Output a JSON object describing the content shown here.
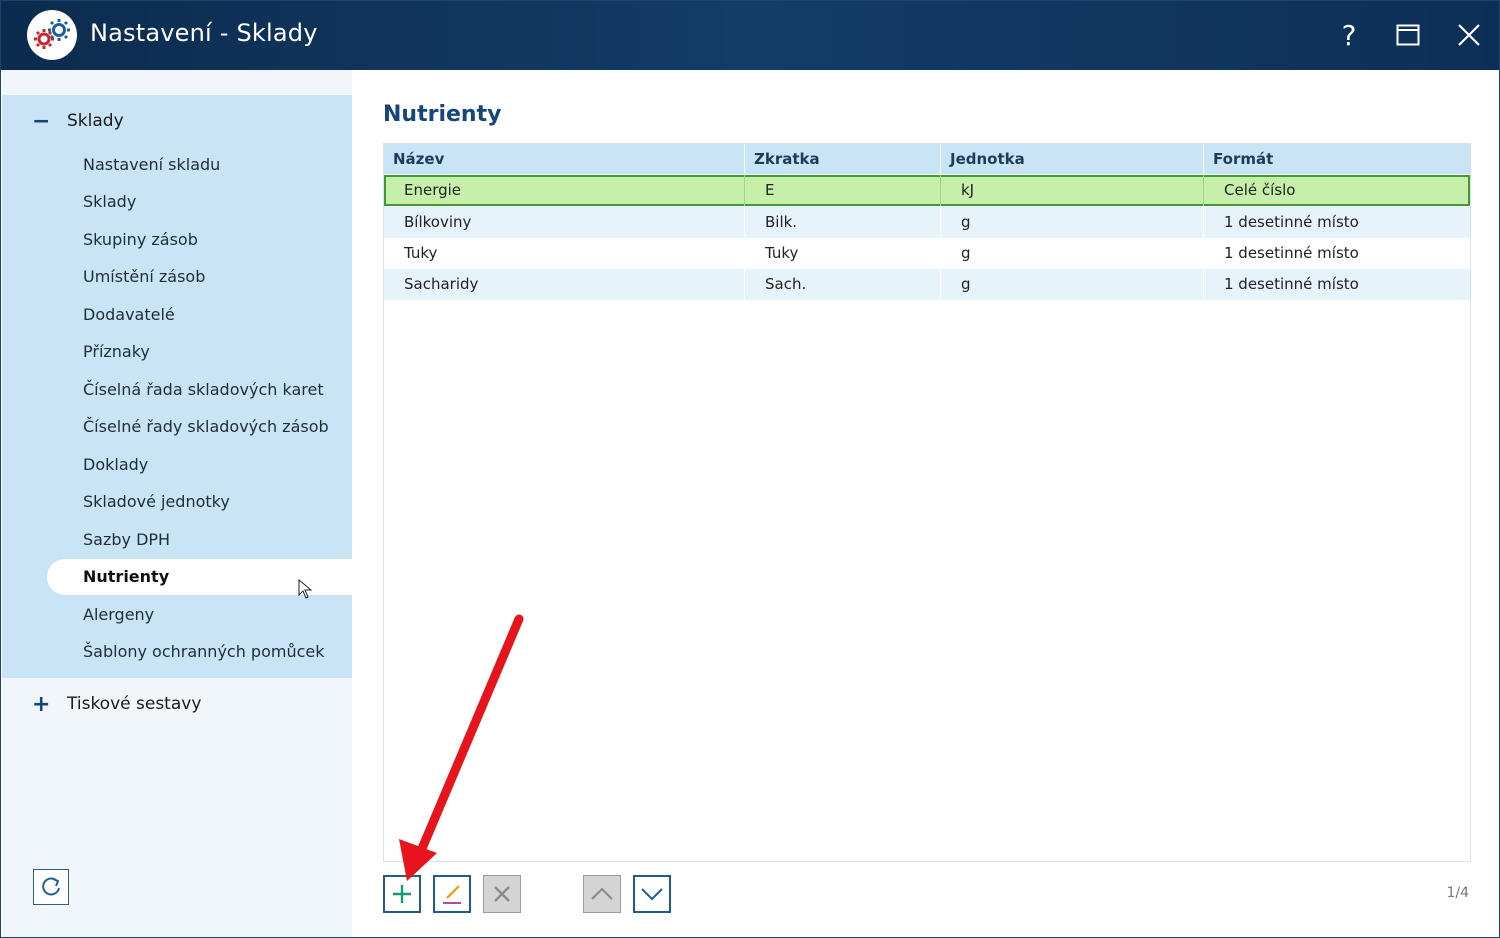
{
  "window": {
    "title": "Nastavení - Sklady",
    "help_label": "?"
  },
  "sidebar": {
    "sklady_group": {
      "sign": "−",
      "label": "Sklady"
    },
    "items": [
      {
        "label": "Nastavení skladu"
      },
      {
        "label": "Sklady"
      },
      {
        "label": "Skupiny zásob"
      },
      {
        "label": "Umístění zásob"
      },
      {
        "label": "Dodavatelé"
      },
      {
        "label": "Příznaky"
      },
      {
        "label": "Číselná řada skladových karet"
      },
      {
        "label": "Číselné řady skladových zásob"
      },
      {
        "label": "Doklady"
      },
      {
        "label": "Skladové jednotky"
      },
      {
        "label": "Sazby DPH"
      },
      {
        "label": "Nutrienty",
        "active": true
      },
      {
        "label": "Alergeny"
      },
      {
        "label": "Šablony ochranných pomůcek"
      }
    ],
    "print_group": {
      "sign": "+",
      "label": "Tiskové sestavy"
    }
  },
  "main": {
    "title": "Nutrienty",
    "columns": [
      "Název",
      "Zkratka",
      "Jednotka",
      "Formát"
    ],
    "rows": [
      [
        "Energie",
        "E",
        "kJ",
        "Celé číslo"
      ],
      [
        "Bílkoviny",
        "Bilk.",
        "g",
        "1 desetinné místo"
      ],
      [
        "Tuky",
        "Tuky",
        "g",
        "1 desetinné místo"
      ],
      [
        "Sacharidy",
        "Sach.",
        "g",
        "1 desetinné místo"
      ]
    ],
    "selected_row": 0,
    "counter": "1/4"
  },
  "colors": {
    "titlebar": "#0c2b4e",
    "accent": "#14467a",
    "sidebar_group": "#c9e4f4",
    "selected_row": "#c6efa9",
    "annotation_arrow": "#e8141b"
  }
}
